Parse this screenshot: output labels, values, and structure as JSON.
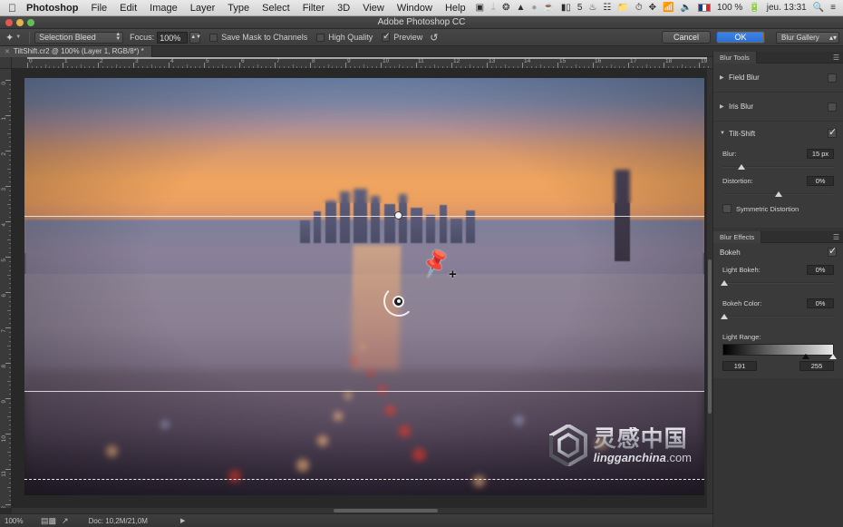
{
  "macbar": {
    "apple_icon": "apple-icon",
    "app_name": "Photoshop",
    "menus": [
      "File",
      "Edit",
      "Image",
      "Layer",
      "Type",
      "Select",
      "Filter",
      "3D",
      "View",
      "Window",
      "Help"
    ],
    "status_items": [
      {
        "name": "screen-recording-icon",
        "glyph": "▣"
      },
      {
        "name": "bluetooth-icon",
        "glyph": "ᛦ"
      },
      {
        "name": "dropbox-icon",
        "glyph": "❂"
      },
      {
        "name": "cloud-icon",
        "glyph": "▲"
      },
      {
        "name": "circle-icon",
        "glyph": "●"
      },
      {
        "name": "coffee-icon",
        "glyph": "☕"
      },
      {
        "name": "audio-meter-icon",
        "glyph": "ᵞ\u0001"
      }
    ],
    "audio_count": "5",
    "battery_percent": "100 %",
    "clock": "jeu. 13:31",
    "search_icon": "search-icon",
    "notification_icon": "notification-center-icon"
  },
  "titlebar": {
    "title": "Adobe Photoshop CC",
    "close": "close-button",
    "minimize": "minimize-button",
    "maximize": "maximize-button"
  },
  "options_bar": {
    "tool_icon": "blur-gallery-tool-icon",
    "selection_bleed_label": "Selection Bleed",
    "focus_label": "Focus:",
    "focus_value": "100%",
    "save_mask_label": "Save Mask to Channels",
    "high_quality_label": "High Quality",
    "preview_label": "Preview",
    "preview_checked": true,
    "save_mask_checked": false,
    "high_quality_checked": false,
    "reset_icon": "reset-icon",
    "cancel_label": "Cancel",
    "ok_label": "OK",
    "workspace_label": "Blur Gallery"
  },
  "document_tab": {
    "title": "TiltShift.cr2 @ 100% (Layer 1, RGB/8*) *",
    "close_icon": "tab-close-icon"
  },
  "rulers": {
    "horizontal_numbers": [
      "0",
      "1",
      "2",
      "3",
      "4",
      "5",
      "6",
      "7",
      "8",
      "9",
      "10",
      "11",
      "12",
      "13",
      "14",
      "15",
      "16",
      "17",
      "18",
      "19"
    ],
    "vertical_numbers": [
      "0",
      "1",
      "2",
      "3",
      "4",
      "5",
      "6",
      "7",
      "8",
      "9",
      "10",
      "11",
      "12"
    ],
    "unit": "inches"
  },
  "canvas": {
    "image_alt": "Aerial sunset view of Paris with La Defense skyline, tilt-shift blur applied",
    "pin_cursor_icon": "pushpin-cursor-icon",
    "add_pin_icon": "plus-icon",
    "blur_pin_icon": "blur-pin-ring",
    "tilt_shift_pin": {
      "x_pct": 55.0,
      "y_pct": 53.5
    },
    "guides": {
      "solid_line_y_pct": 75.0,
      "dashed_line_y_pct": 96.0,
      "upper_solid_y_pct": 33.0
    },
    "watermark": {
      "chinese": "灵感中国",
      "latin_bold": "lingganchina",
      "latin_suffix": ".com",
      "logo_icon": "lingganchina-hex-logo"
    }
  },
  "status_bar": {
    "zoom": "100%",
    "icons": [
      "mask-icon",
      "arrow-icon"
    ],
    "doc_label": "Doc: 10,2M/21,0M",
    "expand_icon": "expand-arrow-icon"
  },
  "blur_tools_panel": {
    "tab_label": "Blur Tools",
    "menu_icon": "panel-menu-icon",
    "items": [
      {
        "name": "Field Blur",
        "expanded": false,
        "enabled": false,
        "triangle": "▶"
      },
      {
        "name": "Iris Blur",
        "expanded": false,
        "enabled": false,
        "triangle": "▶"
      },
      {
        "name": "Tilt-Shift",
        "expanded": true,
        "enabled": true,
        "triangle": "▼"
      }
    ],
    "tilt_shift_controls": {
      "blur_label": "Blur:",
      "blur_value": "15 px",
      "blur_slider_pct": 17,
      "distortion_label": "Distortion:",
      "distortion_value": "0%",
      "distortion_slider_pct": 50,
      "symmetric_label": "Symmetric Distortion",
      "symmetric_checked": false
    }
  },
  "blur_effects_panel": {
    "tab_label": "Blur Effects",
    "menu_icon": "panel-menu-icon",
    "bokeh_label": "Bokeh",
    "bokeh_checked": true,
    "light_bokeh_label": "Light Bokeh:",
    "light_bokeh_value": "0%",
    "light_bokeh_slider_pct": 2,
    "bokeh_color_label": "Bokeh Color:",
    "bokeh_color_value": "0%",
    "bokeh_color_slider_pct": 2,
    "light_range_label": "Light Range:",
    "light_range_min": "191",
    "light_range_max": "255",
    "light_range_min_pct": 75,
    "light_range_max_pct": 100
  },
  "colors": {
    "accent_blue": "#2b6ed0",
    "panel_bg": "#3a3a3a",
    "app_bg": "#2b2b2b",
    "canvas_bg": "#282828"
  }
}
